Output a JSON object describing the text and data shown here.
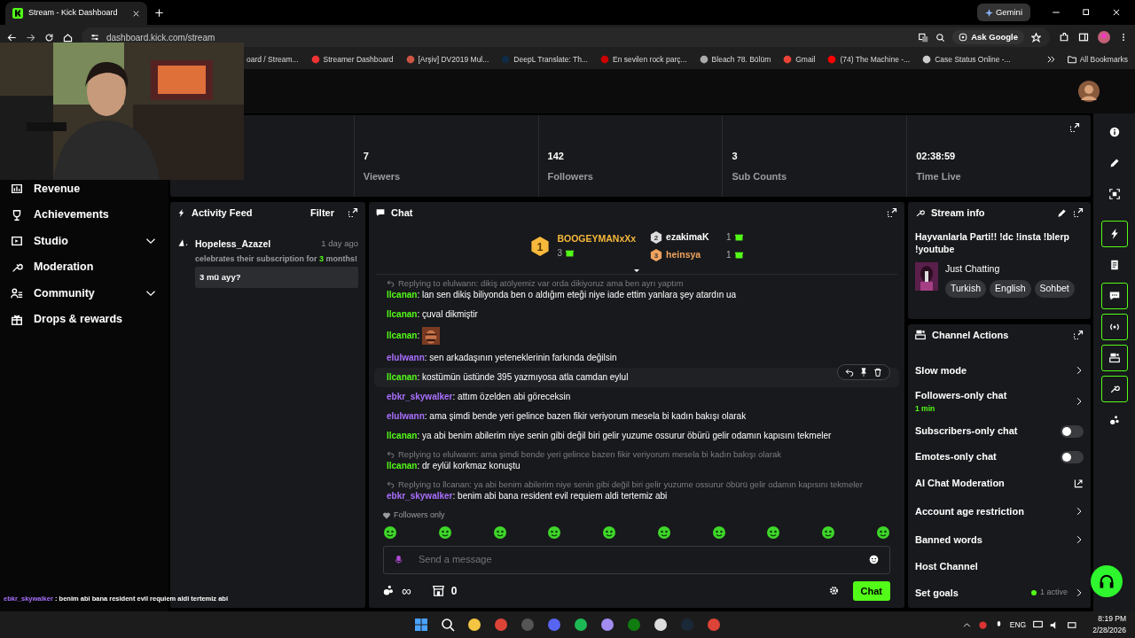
{
  "browser": {
    "tab_title": "Stream - Kick Dashboard",
    "url": "dashboard.kick.com/stream",
    "gemini": "Gemini",
    "ask_google": "Ask Google",
    "bookmarks": [
      "oard / Stream...",
      "Streamer Dashboard",
      "[Arşiv] DV2019 Mul...",
      "DeepL Translate: Th...",
      "En sevilen rock parç...",
      "Bleach 78. Bölüm",
      "Gmail",
      "(74) The Machine -...",
      "Case Status Online -..."
    ],
    "all_bookmarks": "All Bookmarks"
  },
  "sidebar": {
    "items": [
      {
        "label": "Revenue",
        "expandable": false
      },
      {
        "label": "Achievements",
        "expandable": false
      },
      {
        "label": "Studio",
        "expandable": true
      },
      {
        "label": "Moderation",
        "expandable": false
      },
      {
        "label": "Community",
        "expandable": true
      },
      {
        "label": "Drops & rewards",
        "expandable": false
      }
    ]
  },
  "stats": [
    {
      "value": "7",
      "label": "Viewers"
    },
    {
      "value": "142",
      "label": "Followers"
    },
    {
      "value": "3",
      "label": "Sub Counts"
    },
    {
      "value": "02:38:59",
      "label": "Time Live"
    }
  ],
  "activity_feed": {
    "title": "Activity Feed",
    "filter": "Filter",
    "events": [
      {
        "user": "Hopeless_Azazel",
        "time": "1 day ago",
        "text_before": "celebrates their subscription for ",
        "count": "3",
        "text_after": " months!",
        "message": "3 mü ayy?"
      }
    ]
  },
  "chat": {
    "title": "Chat",
    "leaderboard": [
      {
        "rank": "1",
        "name": "BOOGEYMANxXx",
        "count": "3",
        "color": "#f6b93b"
      },
      {
        "rank": "2",
        "name": "ezakimaK",
        "count": "1",
        "color": "#ffffff"
      },
      {
        "rank": "3",
        "name": "heinsya",
        "count": "1",
        "color": "#f0a35e"
      }
    ],
    "messages": [
      {
        "kind": "text",
        "reply": "Replying to elulwann: dikiş atölyemiz var orda dikiyoruz ama ben ayrı yaptım",
        "user": "llcanan",
        "color": "#53fc18",
        "text": ": lan sen dikiş biliyonda ben o aldığım eteği niye iade ettim yanlara şey atardın ua",
        "hovered": false
      },
      {
        "kind": "text",
        "user": "llcanan",
        "color": "#53fc18",
        "text": ": çuval dikmiştir",
        "hovered": false
      },
      {
        "kind": "emote",
        "user": "llcanan",
        "color": "#53fc18",
        "text": ":",
        "hovered": false
      },
      {
        "kind": "text",
        "user": "elulwann",
        "color": "#a970ff",
        "text": ": sen arkadaşının yeteneklerinin farkında değilsin",
        "hovered": false
      },
      {
        "kind": "text",
        "user": "llcanan",
        "color": "#53fc18",
        "text": ": kostümün üstünde 395 yazmıyosa atla camdan eylul",
        "hovered": true
      },
      {
        "kind": "text",
        "user": "ebkr_skywalker",
        "color": "#a970ff",
        "text": ": attım özelden abi göreceksin",
        "hovered": false
      },
      {
        "kind": "text",
        "user": "elulwann",
        "color": "#a970ff",
        "text": ": ama şimdi bende yeri gelince bazen fikir veriyorum mesela bi kadın bakışı olarak",
        "hovered": false
      },
      {
        "kind": "text",
        "user": "llcanan",
        "color": "#53fc18",
        "text": ": ya abi benim abilerim niye senin gibi değil biri gelir yuzume ossurur öbürü gelir odamın kapısını tekmeler",
        "hovered": false
      },
      {
        "kind": "text",
        "reply": "Replying to elulwann: ama şimdi bende yeri gelince bazen fikir veriyorum mesela bi kadın bakışı olarak",
        "user": "llcanan",
        "color": "#53fc18",
        "text": ": dr eylül korkmaz konuştu",
        "hovered": false
      },
      {
        "kind": "text",
        "reply": "Replying to llcanan: ya abi benim abilerim niye senin gibi değil biri gelir yuzume ossurur öbürü gelir odamın kapısını tekmeler",
        "user": "ebkr_skywalker",
        "color": "#a970ff",
        "text": ": benim abi bana resident evil requiem aldi tertemiz abi",
        "hovered": false
      }
    ],
    "mode": "Followers only",
    "input": {
      "placeholder": "Send a message"
    },
    "points": "∞",
    "kicks": "0",
    "send": "Chat"
  },
  "stream_info": {
    "title": "Stream info",
    "stream_title": "Hayvanlarla Parti!! !dc !insta !blerp !youtube",
    "category": "Just Chatting",
    "tags": [
      "Turkish",
      "English",
      "Sohbet"
    ]
  },
  "channel_actions": {
    "title": "Channel Actions",
    "items": [
      {
        "kind": "arrow",
        "label": "Slow mode"
      },
      {
        "kind": "arrow",
        "label": "Followers-only chat",
        "detail": "1 min"
      },
      {
        "kind": "toggle",
        "label": "Subscribers-only chat",
        "on": false
      },
      {
        "kind": "toggle",
        "label": "Emotes-only chat",
        "on": false
      },
      {
        "kind": "external",
        "label": "AI Chat Moderation"
      },
      {
        "kind": "arrow",
        "label": "Account age restriction"
      },
      {
        "kind": "arrow",
        "label": "Banned words"
      },
      {
        "kind": "plain",
        "label": "Host Channel"
      },
      {
        "kind": "arrow",
        "label": "Set goals",
        "status": "1 active"
      }
    ]
  },
  "rail": [
    {
      "active": false
    },
    {
      "active": false
    },
    {
      "active": false
    },
    {
      "active": true
    },
    {
      "active": false
    },
    {
      "active": true
    },
    {
      "active": true
    },
    {
      "active": true
    },
    {
      "active": true
    },
    {
      "active": false
    }
  ],
  "overlay_chat": {
    "user": "ebkr_skywalker",
    "text": ": benim abi bana resident evil requiem aldi tertemiz abi"
  },
  "taskbar": {
    "language": "ENG",
    "time": "8:19 PM",
    "date": "2/28/2026"
  }
}
